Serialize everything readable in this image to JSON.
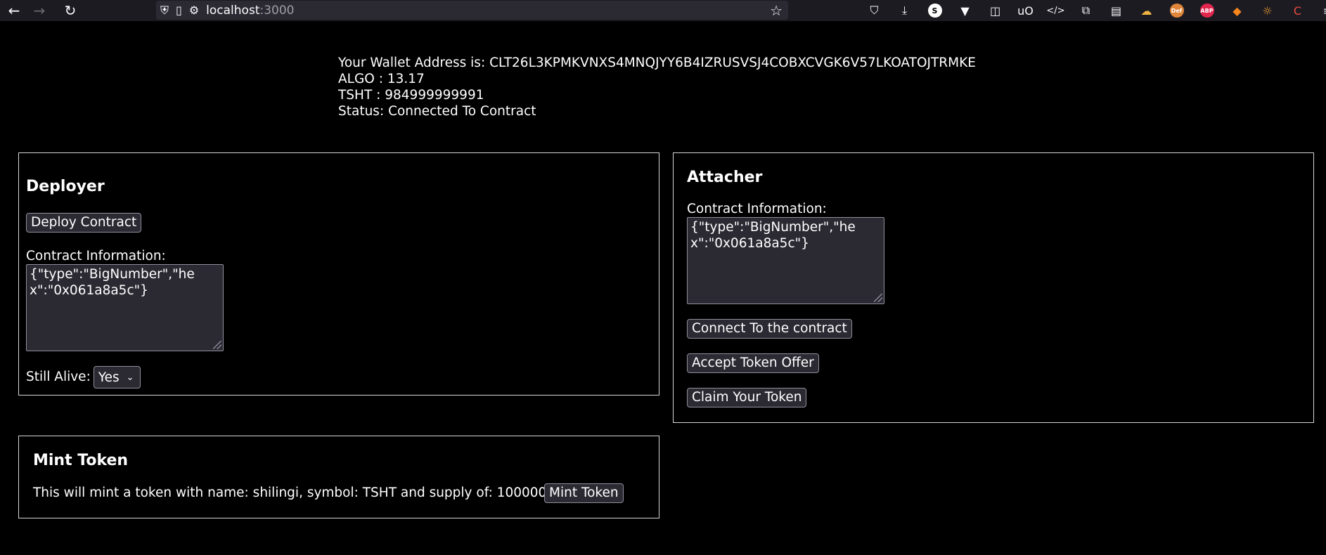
{
  "browser": {
    "url_host": "localhost",
    "url_port": ":3000",
    "extensions": [
      {
        "name": "pocket-icon",
        "glyph": "⛉"
      },
      {
        "name": "download-icon",
        "glyph": "⤓"
      },
      {
        "name": "s-extension-icon",
        "glyph": "S"
      },
      {
        "name": "v-extension-icon",
        "glyph": "▼"
      },
      {
        "name": "glasses-extension-icon",
        "glyph": "◫"
      },
      {
        "name": "ublock-icon",
        "glyph": "uO"
      },
      {
        "name": "devtools-icon",
        "glyph": "</>"
      },
      {
        "name": "screen-icon",
        "glyph": "⧉"
      },
      {
        "name": "reader-icon",
        "glyph": "▤"
      },
      {
        "name": "fox-extension-icon",
        "glyph": "☁"
      },
      {
        "name": "def-extension-icon",
        "glyph": "Def"
      },
      {
        "name": "abp-icon",
        "glyph": "ABP"
      },
      {
        "name": "metamask-icon",
        "glyph": "◆"
      },
      {
        "name": "sun-extension-icon",
        "glyph": "☼"
      },
      {
        "name": "c-extension-icon",
        "glyph": "C"
      },
      {
        "name": "menu-icon",
        "glyph": "≡"
      }
    ]
  },
  "wallet": {
    "address_line": "Your Wallet Address is: CLT26L3KPMKVNXS4MNQJYY6B4IZRUSVSJ4COBXCVGK6V57LKOATOJTRMKE",
    "algo_line": "ALGO : 13.17",
    "tsht_line": "TSHT : 984999999991",
    "status_line": "Status: Connected To Contract"
  },
  "deployer": {
    "title": "Deployer",
    "deploy_button": "Deploy Contract",
    "contract_info_label": "Contract Information:",
    "contract_info_value": "{\"type\":\"BigNumber\",\"hex\":\"0x061a8a5c\"}",
    "still_alive_label": "Still Alive:",
    "still_alive_value": "Yes"
  },
  "attacher": {
    "title": "Attacher",
    "contract_info_label": "Contract Information:",
    "contract_info_value": "{\"type\":\"BigNumber\",\"hex\":\"0x061a8a5c\"}",
    "connect_button": "Connect To the contract",
    "accept_button": "Accept Token Offer",
    "claim_button": "Claim Your Token"
  },
  "mint": {
    "title": "Mint Token",
    "description": "This will mint a token with name: shilingi, symbol: TSHT and supply of: 1000000:",
    "mint_button": "Mint Token"
  }
}
